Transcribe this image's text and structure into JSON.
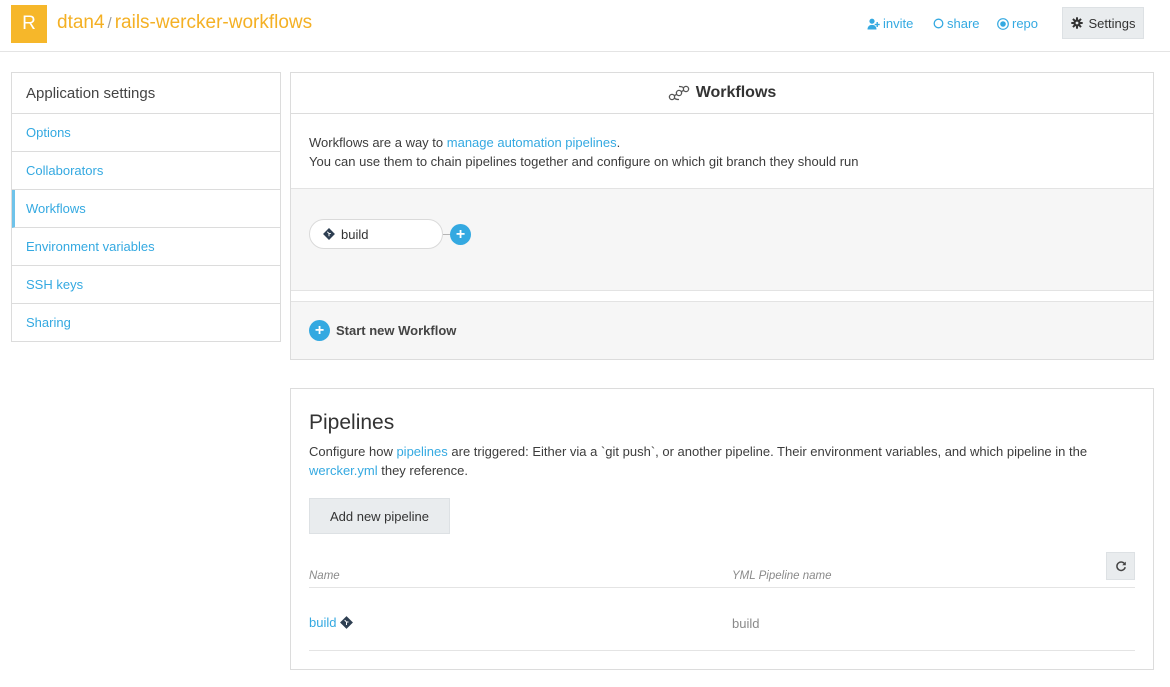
{
  "header": {
    "logo_letter": "R",
    "owner": "dtan4",
    "separator": "/",
    "app_name": "rails-wercker-workflows",
    "links": {
      "invite": "invite",
      "share": "share",
      "repo": "repo"
    },
    "settings_label": "Settings"
  },
  "sidebar": {
    "title": "Application settings",
    "items": [
      {
        "label": "Options",
        "active": false
      },
      {
        "label": "Collaborators",
        "active": false
      },
      {
        "label": "Workflows",
        "active": true
      },
      {
        "label": "Environment variables",
        "active": false
      },
      {
        "label": "SSH keys",
        "active": false
      },
      {
        "label": "Sharing",
        "active": false
      }
    ]
  },
  "workflows": {
    "title": "Workflows",
    "desc_prefix": "Workflows are a way to ",
    "desc_link": "manage automation pipelines",
    "desc_suffix": ".",
    "desc_line2": "You can use them to chain pipelines together and configure on which git branch they should run",
    "pipeline_node": "build",
    "start_new_label": "Start new Workflow"
  },
  "pipelines": {
    "title": "Pipelines",
    "desc_part1": "Configure how ",
    "desc_link1": "pipelines",
    "desc_part2": " are triggered: Either via a `git push`, or another pipeline. Their environment variables, and which pipeline in the ",
    "desc_link2": "wercker.yml",
    "desc_part3": " they reference.",
    "add_button": "Add new pipeline",
    "columns": {
      "name": "Name",
      "yml": "YML Pipeline name"
    },
    "rows": [
      {
        "name": "build",
        "yml": "build"
      }
    ]
  },
  "colors": {
    "accent_blue": "#34a9e1",
    "brand_orange": "#f4b024",
    "logo_bg": "#f6b72a"
  }
}
